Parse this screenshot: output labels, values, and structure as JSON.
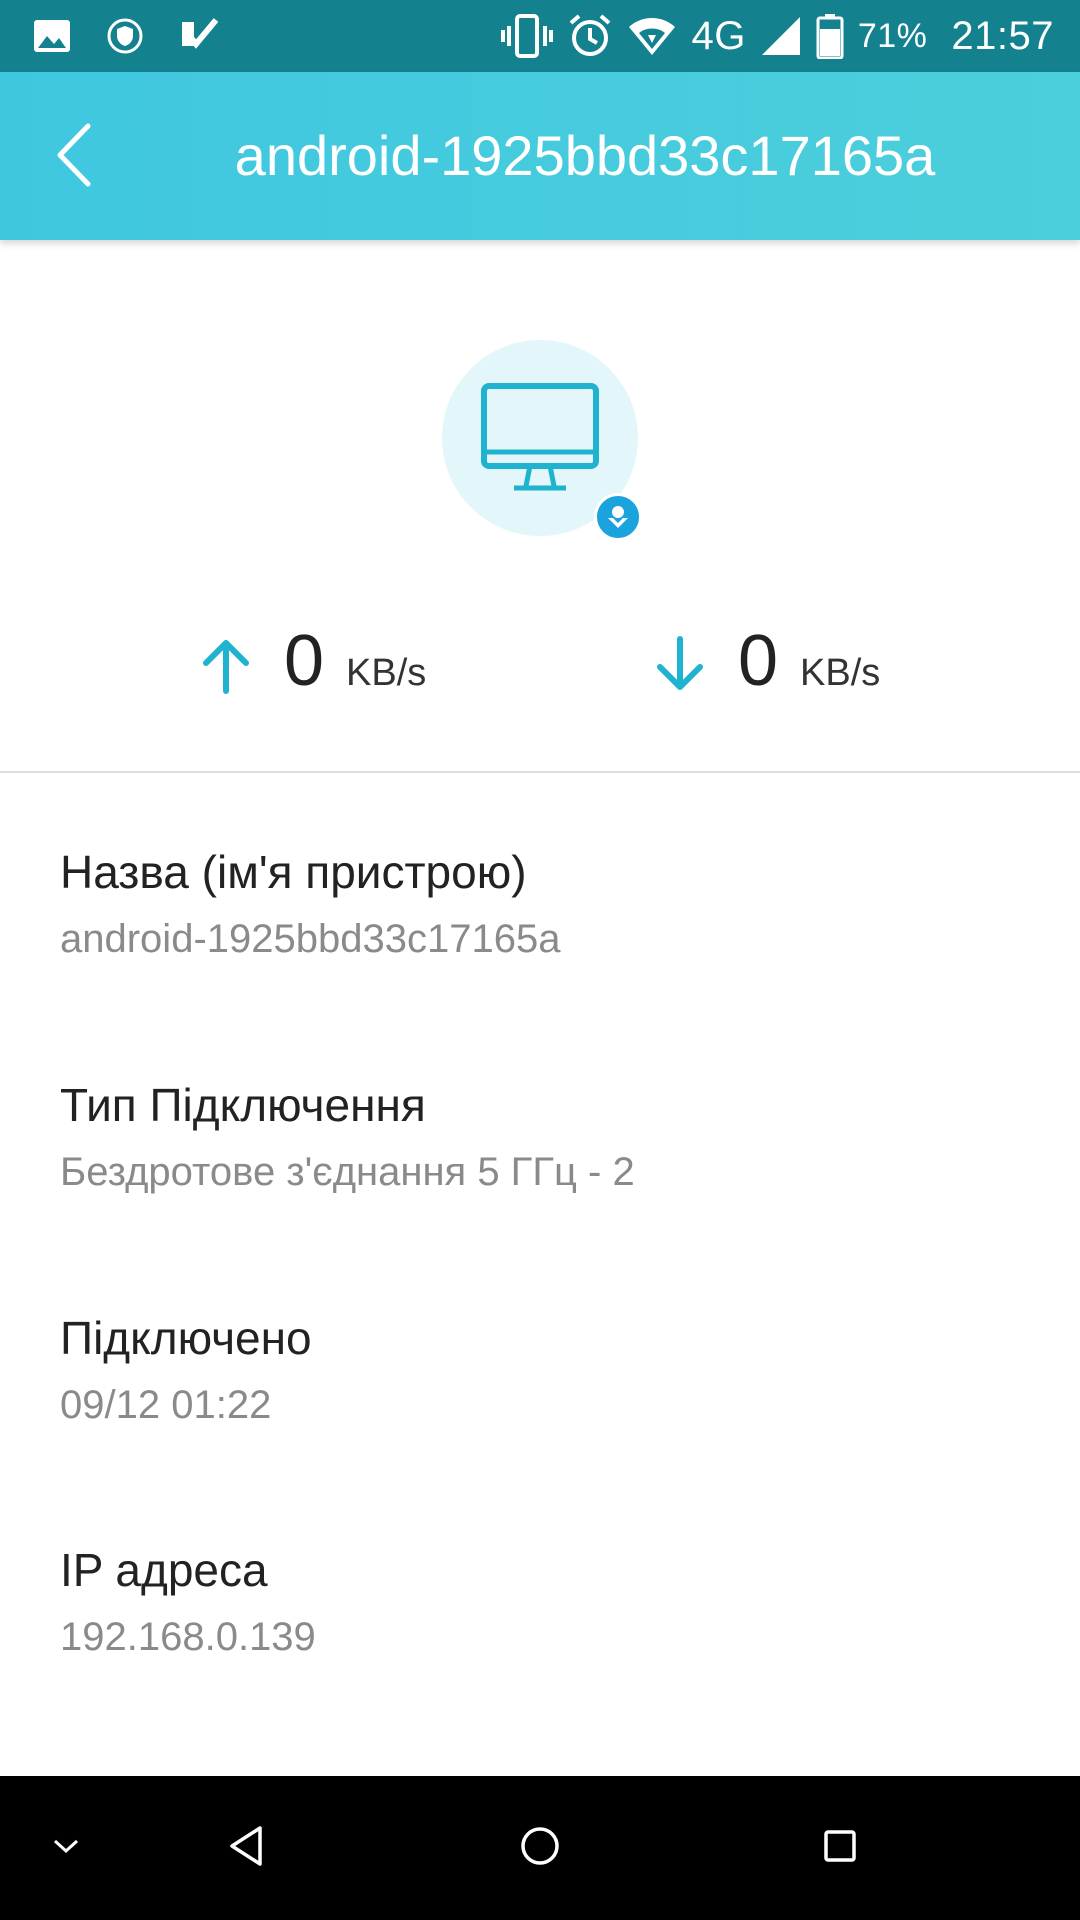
{
  "status_bar": {
    "left_icons": [
      "image-icon",
      "shield-icon",
      "check-icon"
    ],
    "right_icons": [
      "vibrate-icon",
      "alarm-icon",
      "wifi-icon"
    ],
    "network": "4G",
    "battery_percent": "71%",
    "time": "21:57"
  },
  "app_bar": {
    "back_icon": "chevron-left-icon",
    "title": "android-1925bbd33c17165a"
  },
  "device": {
    "icon": "monitor-icon",
    "badge_icon": "android-badge-icon"
  },
  "speeds": {
    "upload_value": "0",
    "upload_unit": "KB/s",
    "download_value": "0",
    "download_unit": "KB/s"
  },
  "info": [
    {
      "label": "Назва (ім'я пристрою)",
      "value": "android-1925bbd33c17165a"
    },
    {
      "label": "Тип Підключення",
      "value": "Бездротове з'єднання 5 ГГц - 2"
    },
    {
      "label": "Підключено",
      "value": "09/12 01:22"
    },
    {
      "label": "IP адреса",
      "value": "192.168.0.139"
    }
  ],
  "nav_bar": {
    "items": [
      "collapse-icon",
      "back-triangle-icon",
      "home-circle-icon",
      "recents-square-icon"
    ]
  },
  "colors": {
    "status_bar": "#14818f",
    "app_bar": "#3fc7e0",
    "accent": "#1fb3cf",
    "badge": "#1aa3dc"
  }
}
